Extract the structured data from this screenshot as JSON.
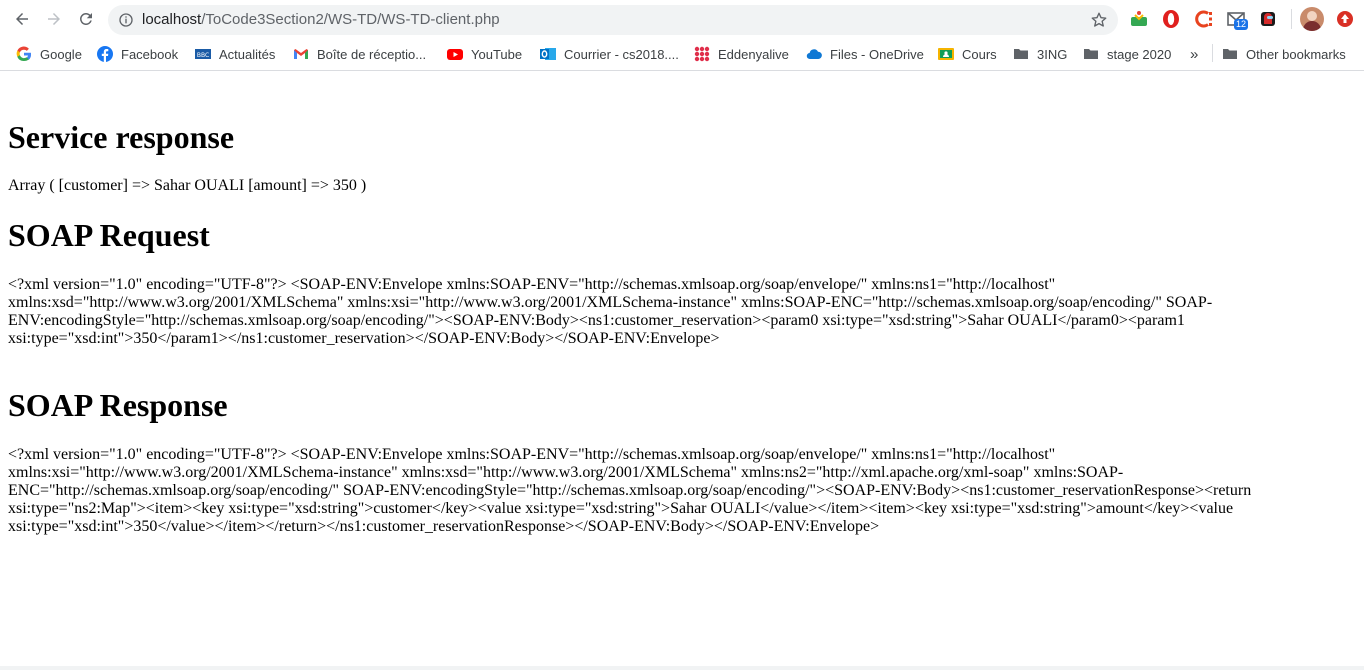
{
  "browser": {
    "url_host": "localhost",
    "url_path": "/ToCode3Section2/WS-TD/WS-TD-client.php",
    "extension_badge": "12",
    "bookmarks": [
      {
        "label": "Google",
        "icon": "google-icon"
      },
      {
        "label": "Facebook",
        "icon": "facebook-icon"
      },
      {
        "label": "Actualités",
        "icon": "news-icon"
      },
      {
        "label": "Boîte de réceptio...",
        "icon": "gmail-icon"
      },
      {
        "label": "YouTube",
        "icon": "youtube-icon"
      },
      {
        "label": "Courrier - cs2018....",
        "icon": "outlook-icon"
      },
      {
        "label": "Eddenyalive",
        "icon": "grid-app-icon"
      },
      {
        "label": "Files - OneDrive",
        "icon": "onedrive-icon"
      },
      {
        "label": "Cours",
        "icon": "classroom-icon"
      },
      {
        "label": "3ING",
        "icon": "folder-icon"
      },
      {
        "label": "stage 2020",
        "icon": "folder-icon"
      }
    ],
    "more_bookmarks": "»",
    "other_bookmarks": "Other bookmarks"
  },
  "page": {
    "service_heading": "Service response",
    "service_text": "Array ( [customer] => Sahar OUALI [amount] => 350 )",
    "request_heading": "SOAP Request",
    "request_text": "<?xml version=\"1.0\" encoding=\"UTF-8\"?> <SOAP-ENV:Envelope xmlns:SOAP-ENV=\"http://schemas.xmlsoap.org/soap/envelope/\" xmlns:ns1=\"http://localhost\" xmlns:xsd=\"http://www.w3.org/2001/XMLSchema\" xmlns:xsi=\"http://www.w3.org/2001/XMLSchema-instance\" xmlns:SOAP-ENC=\"http://schemas.xmlsoap.org/soap/encoding/\" SOAP-ENV:encodingStyle=\"http://schemas.xmlsoap.org/soap/encoding/\"><SOAP-ENV:Body><ns1:customer_reservation><param0 xsi:type=\"xsd:string\">Sahar OUALI</param0><param1 xsi:type=\"xsd:int\">350</param1></ns1:customer_reservation></SOAP-ENV:Body></SOAP-ENV:Envelope>",
    "response_heading": "SOAP Response",
    "response_text": "<?xml version=\"1.0\" encoding=\"UTF-8\"?> <SOAP-ENV:Envelope xmlns:SOAP-ENV=\"http://schemas.xmlsoap.org/soap/envelope/\" xmlns:ns1=\"http://localhost\" xmlns:xsi=\"http://www.w3.org/2001/XMLSchema-instance\" xmlns:xsd=\"http://www.w3.org/2001/XMLSchema\" xmlns:ns2=\"http://xml.apache.org/xml-soap\" xmlns:SOAP-ENC=\"http://schemas.xmlsoap.org/soap/encoding/\" SOAP-ENV:encodingStyle=\"http://schemas.xmlsoap.org/soap/encoding/\"><SOAP-ENV:Body><ns1:customer_reservationResponse><return xsi:type=\"ns2:Map\"><item><key xsi:type=\"xsd:string\">customer</key><value xsi:type=\"xsd:string\">Sahar OUALI</value></item><item><key xsi:type=\"xsd:string\">amount</key><value xsi:type=\"xsd:int\">350</value></item></return></ns1:customer_reservationResponse></SOAP-ENV:Body></SOAP-ENV:Envelope>"
  }
}
